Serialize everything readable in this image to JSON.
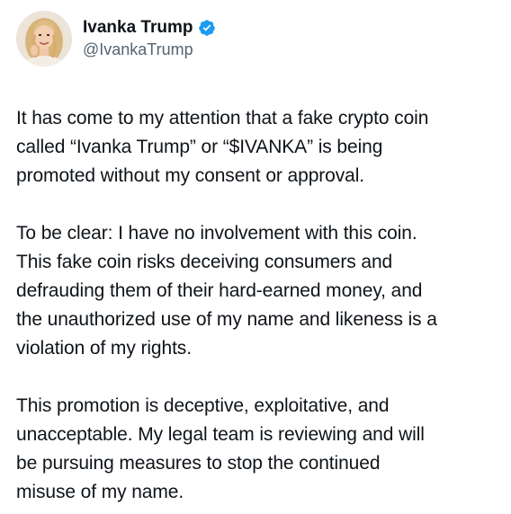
{
  "author": {
    "display_name": "Ivanka Trump",
    "handle": "@IvankaTrump",
    "verified_color": "#1d9bf0"
  },
  "icons": {
    "avatar": "profile-photo",
    "verified": "verified-badge-icon"
  },
  "paragraphs": [
    {
      "lines": [
        "It has come to my attention that a fake crypto coin",
        "called “Ivanka Trump” or “$IVANKA” is being",
        "promoted without my consent or approval."
      ]
    },
    {
      "lines": [
        "To be clear: I have no involvement with this coin.",
        "This fake coin risks deceiving consumers and",
        "defrauding them of their hard-earned money, and",
        "the unauthorized use of my name and likeness is a",
        "violation of my rights."
      ]
    },
    {
      "lines": [
        "This promotion is deceptive, exploitative, and",
        "unacceptable. My legal team is reviewing and will",
        "be pursuing measures to stop the continued",
        "misuse of my name."
      ]
    }
  ]
}
